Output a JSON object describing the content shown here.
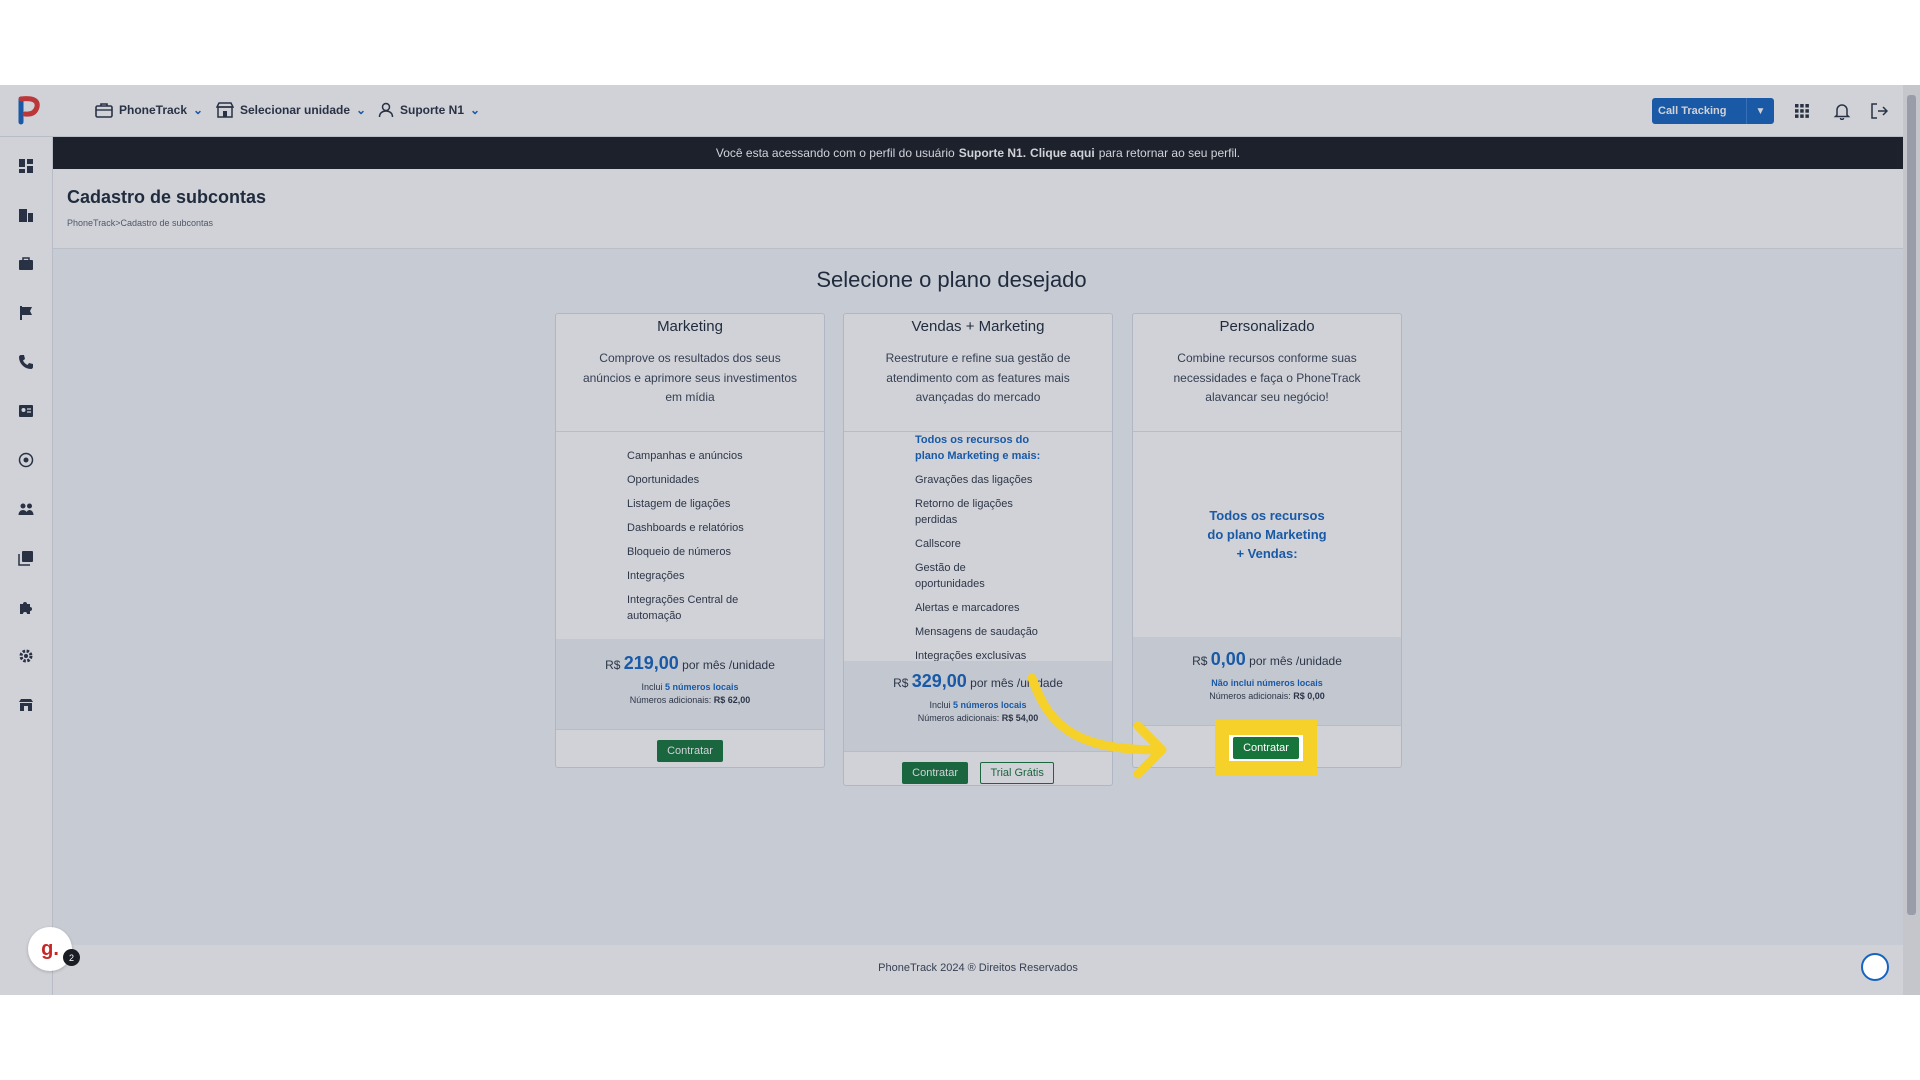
{
  "topbar": {
    "nav": [
      {
        "label": "PhoneTrack",
        "icon": "briefcase-icon"
      },
      {
        "label": "Selecionar unidade",
        "icon": "store-icon"
      },
      {
        "label": "Suporte N1",
        "icon": "user-icon"
      }
    ],
    "product_button": "Call Tracking",
    "icons": [
      "apps-grid-icon",
      "bell-icon",
      "logout-icon"
    ]
  },
  "sidebar": {
    "icons": [
      "dashboard-icon",
      "building-icon",
      "briefcase-icon",
      "flag-icon",
      "phone-icon",
      "contact-card-icon",
      "target-icon",
      "users-icon",
      "library-icon",
      "puzzle-icon",
      "gear-icon",
      "store-icon"
    ]
  },
  "banner": {
    "prefix": "Você esta acessando com o perfil do usuário",
    "user": "Suporte N1.",
    "link": "Clique aqui",
    "suffix": "para retornar ao seu perfil."
  },
  "header": {
    "title": "Cadastro de subcontas",
    "breadcrumb": "PhoneTrack>Cadastro de subcontas"
  },
  "main": {
    "title": "Selecione o plano desejado",
    "plans": [
      {
        "name": "Marketing",
        "description": "Comprove os resultados dos seus anúncios e aprimore seus investimentos em mídia",
        "features": [
          "Campanhas e anúncios",
          "Oportunidades",
          "Listagem de ligações",
          "Dashboards e relatórios",
          "Bloqueio de números",
          "Integrações",
          "Integrações Central de automação"
        ],
        "currency": "R$",
        "price": "219,00",
        "period": "por mês /unidade",
        "includes_prefix": "Inclui",
        "includes_link": "5 números locais",
        "extra_label": "Números adicionais:",
        "extra_value": "R$ 62,00",
        "buttons": [
          "Contratar"
        ]
      },
      {
        "name": "Vendas + Marketing",
        "description": "Reestruture e refine sua gestão de atendimento com as features mais avançadas do mercado",
        "highlight": "Todos os recursos do plano Marketing e mais:",
        "features": [
          "Gravações das ligações",
          "Retorno de ligações perdidas",
          "Callscore",
          "Gestão de oportunidades",
          "Alertas e marcadores",
          "Mensagens de saudação",
          "Integrações exclusivas"
        ],
        "currency": "R$",
        "price": "329,00",
        "period": "por mês /unidade",
        "includes_prefix": "Inclui",
        "includes_link": "5 números locais",
        "extra_label": "Números adicionais:",
        "extra_value": "R$ 54,00",
        "buttons": [
          "Contratar",
          "Trial Grátis"
        ]
      },
      {
        "name": "Personalizado",
        "description": "Combine recursos conforme suas necessidades e faça o PhoneTrack alavancar seu negócio!",
        "highlight": "Todos os recursos do plano Marketing + Vendas:",
        "currency": "R$",
        "price": "0,00",
        "period": "por mês /unidade",
        "includes_link": "Não inclui números locais",
        "extra_label": "Números adicionais:",
        "extra_value": "R$ 0,00",
        "buttons": [
          "Contratar"
        ]
      }
    ]
  },
  "footer": {
    "text": "PhoneTrack 2024 ® Direitos Reservados"
  },
  "widgets": {
    "g_letter": "g.",
    "g_badge": "2"
  },
  "colors": {
    "primary": "#1565c0",
    "success": "#17753c",
    "highlight": "#f5d12a",
    "banner": "#1a1d24"
  }
}
